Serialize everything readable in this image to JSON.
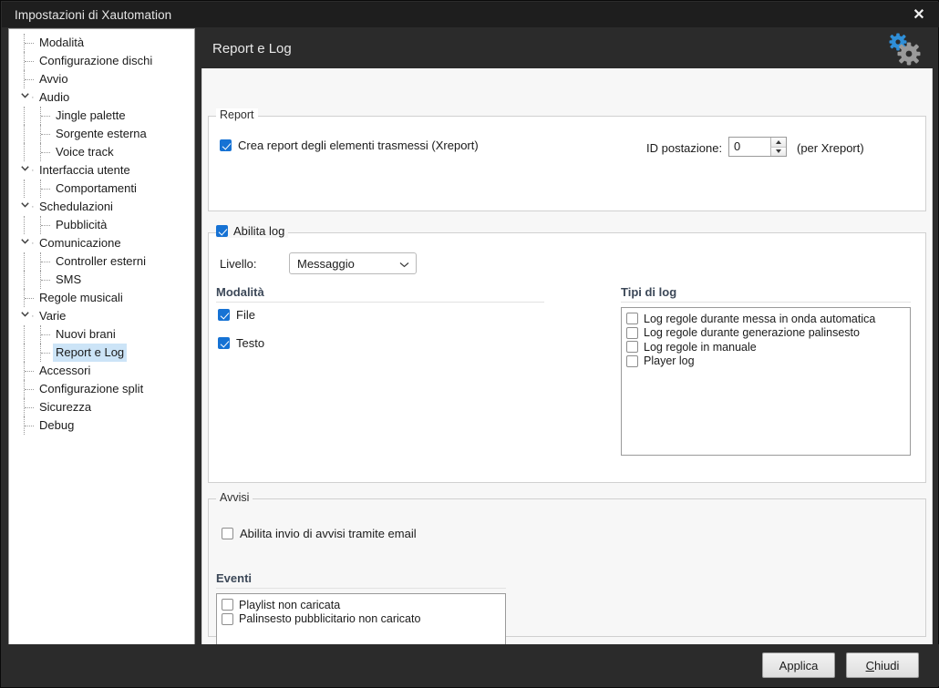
{
  "window": {
    "title": "Impostazioni di Xautomation",
    "close_icon": "close-icon"
  },
  "sidebar": {
    "items": [
      {
        "label": "Modalità",
        "level": 0,
        "expandable": false,
        "selected": false
      },
      {
        "label": "Configurazione dischi",
        "level": 0,
        "expandable": false,
        "selected": false
      },
      {
        "label": "Avvio",
        "level": 0,
        "expandable": false,
        "selected": false
      },
      {
        "label": "Audio",
        "level": 0,
        "expandable": true,
        "selected": false
      },
      {
        "label": "Jingle palette",
        "level": 1,
        "expandable": false,
        "selected": false
      },
      {
        "label": "Sorgente esterna",
        "level": 1,
        "expandable": false,
        "selected": false
      },
      {
        "label": "Voice track",
        "level": 1,
        "expandable": false,
        "selected": false
      },
      {
        "label": "Interfaccia utente",
        "level": 0,
        "expandable": true,
        "selected": false
      },
      {
        "label": "Comportamenti",
        "level": 1,
        "expandable": false,
        "selected": false
      },
      {
        "label": "Schedulazioni",
        "level": 0,
        "expandable": true,
        "selected": false
      },
      {
        "label": "Pubblicità",
        "level": 1,
        "expandable": false,
        "selected": false
      },
      {
        "label": "Comunicazione",
        "level": 0,
        "expandable": true,
        "selected": false
      },
      {
        "label": "Controller esterni",
        "level": 1,
        "expandable": false,
        "selected": false
      },
      {
        "label": "SMS",
        "level": 1,
        "expandable": false,
        "selected": false
      },
      {
        "label": "Regole musicali",
        "level": 0,
        "expandable": false,
        "selected": false
      },
      {
        "label": "Varie",
        "level": 0,
        "expandable": true,
        "selected": false
      },
      {
        "label": "Nuovi brani",
        "level": 1,
        "expandable": false,
        "selected": false
      },
      {
        "label": "Report e Log",
        "level": 1,
        "expandable": false,
        "selected": true
      },
      {
        "label": "Accessori",
        "level": 0,
        "expandable": false,
        "selected": false
      },
      {
        "label": "Configurazione split",
        "level": 0,
        "expandable": false,
        "selected": false
      },
      {
        "label": "Sicurezza",
        "level": 0,
        "expandable": false,
        "selected": false
      },
      {
        "label": "Debug",
        "level": 0,
        "expandable": false,
        "selected": false
      }
    ]
  },
  "page": {
    "title": "Report e Log",
    "gears_icon": "gears-icon"
  },
  "report_group": {
    "title": "Report",
    "create_report_label": "Crea report degli elementi trasmessi (Xreport)",
    "create_report_checked": true,
    "id_postazione_label": "ID postazione:",
    "id_postazione_value": "0",
    "id_postazione_suffix": "(per Xreport)"
  },
  "log_group": {
    "title": "Abilita log",
    "enabled": true,
    "level_label": "Livello:",
    "level_value": "Messaggio",
    "level_options": [
      "Messaggio"
    ],
    "modalita_header": "Modalità",
    "modalita_items": [
      {
        "label": "File",
        "checked": true
      },
      {
        "label": "Testo",
        "checked": true
      }
    ],
    "tipi_header": "Tipi di log",
    "tipi_items": [
      {
        "label": "Log regole durante messa in onda automatica",
        "checked": false
      },
      {
        "label": "Log regole durante generazione palinsesto",
        "checked": false
      },
      {
        "label": "Log regole in manuale",
        "checked": false
      },
      {
        "label": "Player log",
        "checked": false
      }
    ]
  },
  "avvisi_group": {
    "title": "Avvisi",
    "email_label": "Abilita invio di avvisi tramite email",
    "email_checked": false,
    "eventi_header": "Eventi",
    "eventi_items": [
      {
        "label": "Playlist non caricata",
        "checked": false
      },
      {
        "label": "Palinsesto pubblicitario non caricato",
        "checked": false
      }
    ]
  },
  "footer": {
    "apply_label": "Applica",
    "close_label": "Chiudi",
    "close_accel": "C",
    "close_rest": "hiudi"
  },
  "colors": {
    "titlebar_bg": "#1e1e1e",
    "window_bg": "#2b2b2b",
    "panel_bg": "#f7f7f7",
    "accent_blue": "#1672d4",
    "selection_blue": "#cce4f7",
    "gear_blue": "#2f8fd8",
    "gear_gray": "#9a9a9a"
  }
}
